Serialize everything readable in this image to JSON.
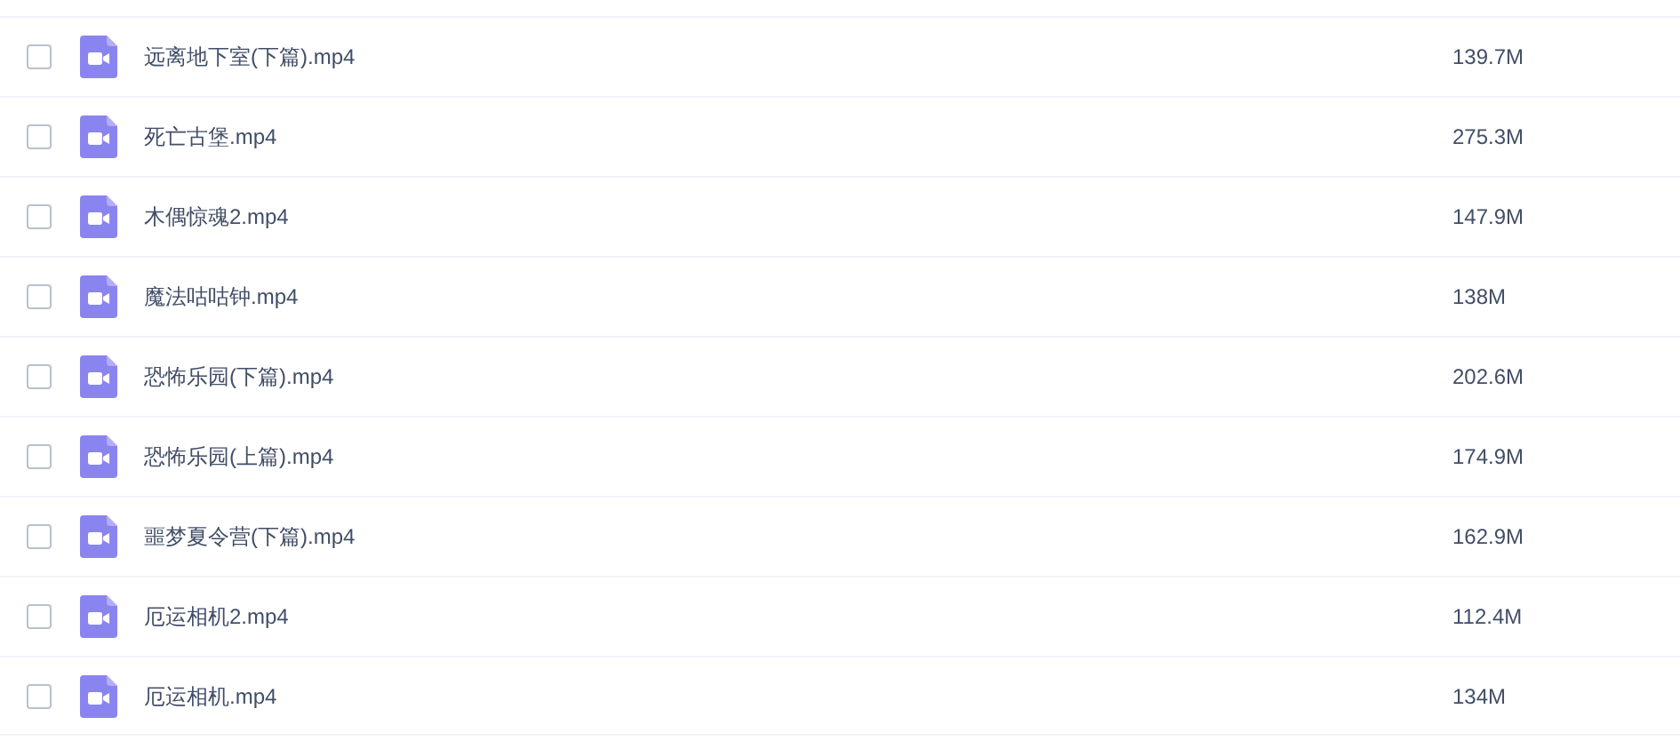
{
  "files": [
    {
      "name": "远离地下室(下篇).mp4",
      "size": "139.7M",
      "checked": false
    },
    {
      "name": "死亡古堡.mp4",
      "size": "275.3M",
      "checked": false
    },
    {
      "name": "木偶惊魂2.mp4",
      "size": "147.9M",
      "checked": false
    },
    {
      "name": "魔法咕咕钟.mp4",
      "size": "138M",
      "checked": false
    },
    {
      "name": "恐怖乐园(下篇).mp4",
      "size": "202.6M",
      "checked": false
    },
    {
      "name": "恐怖乐园(上篇).mp4",
      "size": "174.9M",
      "checked": false
    },
    {
      "name": "噩梦夏令营(下篇).mp4",
      "size": "162.9M",
      "checked": false
    },
    {
      "name": "厄运相机2.mp4",
      "size": "112.4M",
      "checked": false
    },
    {
      "name": "厄运相机.mp4",
      "size": "134M",
      "checked": false
    }
  ]
}
